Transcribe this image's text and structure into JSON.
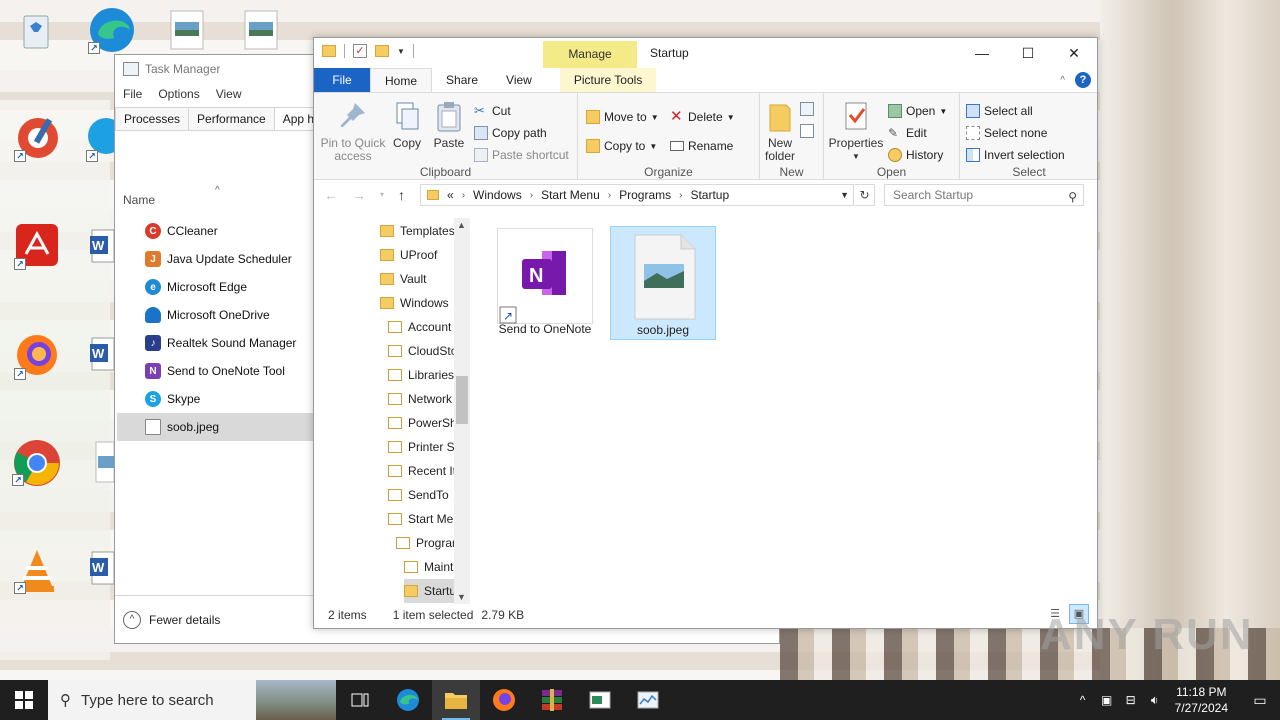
{
  "task_manager": {
    "title": "Task Manager",
    "menu": [
      "File",
      "Options",
      "View"
    ],
    "tabs": [
      "Processes",
      "Performance",
      "App histo"
    ],
    "column_header": "Name",
    "startup_items": [
      {
        "name": "CCleaner",
        "icon": "ccleaner-icon",
        "color": "#d83b2b"
      },
      {
        "name": "Java Update Scheduler",
        "icon": "java-icon",
        "color": "#e07a2c"
      },
      {
        "name": "Microsoft Edge",
        "icon": "edge-icon",
        "color": "#1f8ad6"
      },
      {
        "name": "Microsoft OneDrive",
        "icon": "onedrive-icon",
        "color": "#1b73c9"
      },
      {
        "name": "Realtek Sound Manager",
        "icon": "realtek-icon",
        "color": "#2a3e8c"
      },
      {
        "name": "Send to OneNote Tool",
        "icon": "onenote-icon",
        "color": "#7b3fb3"
      },
      {
        "name": "Skype",
        "icon": "skype-icon",
        "color": "#1da1e2"
      },
      {
        "name": "soob.jpeg",
        "icon": "file-icon",
        "color": "#ffffff"
      }
    ],
    "footer": "Fewer details"
  },
  "explorer": {
    "title": "Startup",
    "manage_tab": "Manage",
    "tabs": {
      "file": "File",
      "home": "Home",
      "share": "Share",
      "view": "View",
      "picture_tools": "Picture Tools"
    },
    "ribbon": {
      "clipboard": {
        "label": "Clipboard",
        "pin": "Pin to Quick access",
        "copy": "Copy",
        "paste": "Paste",
        "cut": "Cut",
        "copy_path": "Copy path",
        "paste_shortcut": "Paste shortcut"
      },
      "organize": {
        "label": "Organize",
        "move_to": "Move to",
        "copy_to": "Copy to",
        "delete": "Delete",
        "rename": "Rename"
      },
      "new": {
        "label": "New",
        "new_folder": "New folder"
      },
      "open": {
        "label": "Open",
        "properties": "Properties",
        "open": "Open",
        "edit": "Edit",
        "history": "History"
      },
      "select": {
        "label": "Select",
        "select_all": "Select all",
        "select_none": "Select none",
        "invert": "Invert selection"
      }
    },
    "address": {
      "prefix": "«",
      "crumbs": [
        "Windows",
        "Start Menu",
        "Programs",
        "Startup"
      ]
    },
    "search_placeholder": "Search Startup",
    "tree": [
      {
        "label": "Templates",
        "indent": 0
      },
      {
        "label": "UProof",
        "indent": 0
      },
      {
        "label": "Vault",
        "indent": 0
      },
      {
        "label": "Windows",
        "indent": 0
      },
      {
        "label": "Account",
        "indent": 1
      },
      {
        "label": "CloudSto",
        "indent": 1
      },
      {
        "label": "Libraries",
        "indent": 1
      },
      {
        "label": "Network",
        "indent": 1
      },
      {
        "label": "PowerSh",
        "indent": 1
      },
      {
        "label": "Printer Sh",
        "indent": 1
      },
      {
        "label": "Recent It",
        "indent": 1
      },
      {
        "label": "SendTo",
        "indent": 1
      },
      {
        "label": "Start Men",
        "indent": 1
      },
      {
        "label": "Program",
        "indent": 2
      },
      {
        "label": "Maint",
        "indent": 3
      },
      {
        "label": "Startu",
        "indent": 3,
        "selected": true
      }
    ],
    "files": [
      {
        "name": "Send to OneNote",
        "icon": "onenote-shortcut-icon"
      },
      {
        "name": "soob.jpeg",
        "icon": "image-file-icon",
        "selected": true
      }
    ],
    "status": {
      "count": "2 items",
      "selection": "1 item selected",
      "size": "2.79 KB"
    }
  },
  "taskbar": {
    "search_placeholder": "Type here to search",
    "time": "11:18 PM",
    "date": "7/27/2024",
    "accent": "#76b9ed"
  },
  "watermark": "ANY RUN"
}
